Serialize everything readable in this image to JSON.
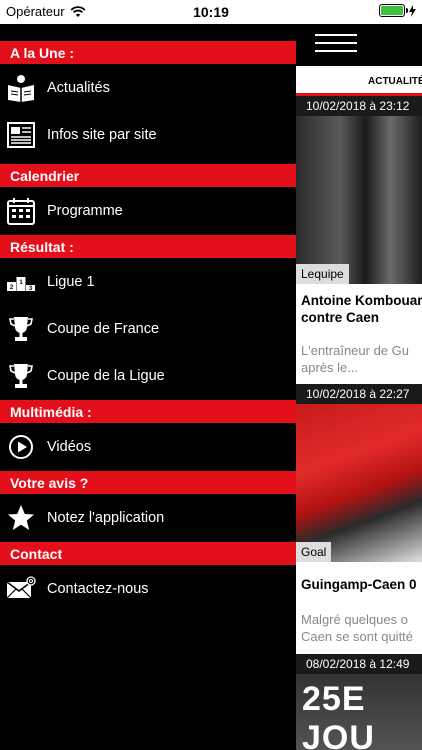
{
  "status_bar": {
    "carrier": "Opérateur",
    "time": "10:19"
  },
  "drawer": {
    "sections": [
      {
        "title": "A la Une :",
        "items": [
          {
            "label": "Actualités",
            "icon": "newspaper-reader-icon"
          },
          {
            "label": "Infos site par site",
            "icon": "newspaper-icon"
          }
        ]
      },
      {
        "title": "Calendrier",
        "items": [
          {
            "label": "Programme",
            "icon": "calendar-icon"
          }
        ]
      },
      {
        "title": "Résultat :",
        "items": [
          {
            "label": "Ligue 1",
            "icon": "podium-icon"
          },
          {
            "label": "Coupe de France",
            "icon": "trophy-icon"
          },
          {
            "label": "Coupe de la Ligue",
            "icon": "trophy-icon"
          }
        ]
      },
      {
        "title": "Multimédia :",
        "items": [
          {
            "label": "Vidéos",
            "icon": "play-circle-icon"
          }
        ]
      },
      {
        "title": "Votre avis ?",
        "items": [
          {
            "label": "Notez l'application",
            "icon": "star-icon"
          }
        ]
      },
      {
        "title": "Contact",
        "items": [
          {
            "label": "Contactez-nous",
            "icon": "mail-icon"
          }
        ]
      }
    ]
  },
  "content": {
    "active_tab": "ACTUALITÉ",
    "articles": [
      {
        "date": "10/02/2018 à 23:12",
        "source": "Lequipe",
        "title_line1": "Antoine Kombouaré",
        "title_line2": "contre Caen",
        "desc_line1": "L'entraîneur de Gu",
        "desc_line2": "après le..."
      },
      {
        "date": "10/02/2018 à 22:27",
        "source": "Goal",
        "title_line1": "Guingamp-Caen 0",
        "desc_line1": "Malgré quelques o",
        "desc_line2": "Caen se sont quitté"
      },
      {
        "date": "08/02/2018 à 12:49",
        "image_text": "25E JOU"
      }
    ]
  },
  "colors": {
    "accent": "#e3101c",
    "battery": "#3fc13f"
  }
}
